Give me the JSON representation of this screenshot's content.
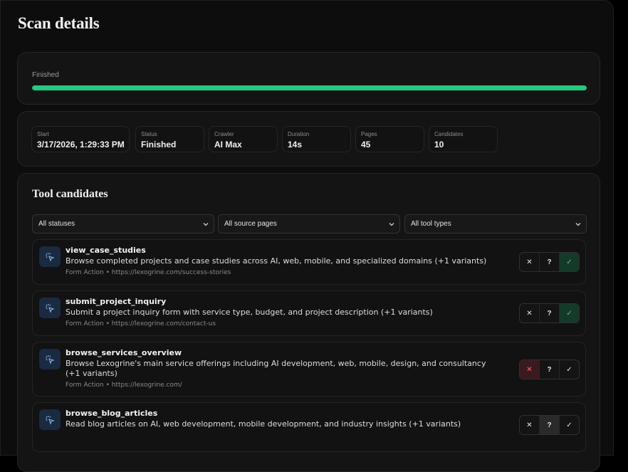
{
  "page": {
    "title": "Scan details"
  },
  "progress": {
    "status_label": "Finished",
    "percent": 100,
    "color": "#28c97e"
  },
  "stats": [
    {
      "label": "Start",
      "value": "3/17/2026, 1:29:33 PM"
    },
    {
      "label": "Status",
      "value": "Finished"
    },
    {
      "label": "Crawler",
      "value": "AI Max"
    },
    {
      "label": "Duration",
      "value": "14s"
    },
    {
      "label": "Pages",
      "value": "45"
    },
    {
      "label": "Candidates",
      "value": "10"
    }
  ],
  "tools": {
    "title": "Tool candidates",
    "filters": {
      "status": "All statuses",
      "source": "All source pages",
      "type": "All tool types"
    },
    "items": [
      {
        "name": "view_case_studies",
        "description": "Browse completed projects and case studies across AI, web, mobile, and specialized domains (+1 variants)",
        "meta": "Form Action • https://lexogrine.com/success-stories",
        "decision": "approve"
      },
      {
        "name": "submit_project_inquiry",
        "description": "Submit a project inquiry form with service type, budget, and project description (+1 variants)",
        "meta": "Form Action • https://lexogrine.com/contact-us",
        "decision": "approve"
      },
      {
        "name": "browse_services_overview",
        "description": "Browse Lexogrine's main service offerings including AI development, web, mobile, design, and consultancy (+1 variants)",
        "meta": "Form Action • https://lexogrine.com/",
        "decision": "reject"
      },
      {
        "name": "browse_blog_articles",
        "description": "Read blog articles on AI, web development, mobile development, and industry insights (+1 variants)",
        "meta": "",
        "decision": "unsure"
      }
    ],
    "buttons": {
      "reject": "✕",
      "unsure": "?",
      "approve": "✓"
    }
  },
  "icons": {
    "item_icon": "cursor-click-icon",
    "select_chevron": "chevron-down-icon"
  }
}
